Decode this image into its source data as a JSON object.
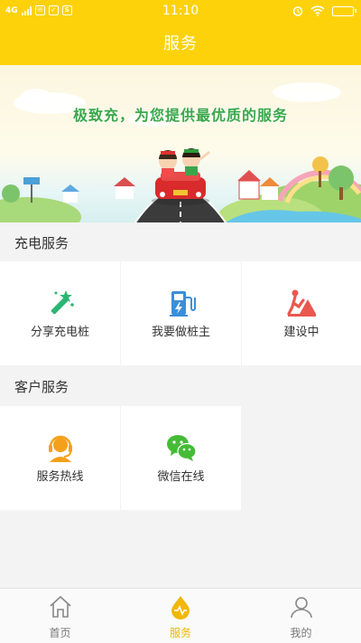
{
  "status_bar": {
    "network": "4G",
    "sim_label": "S",
    "time": "11:10"
  },
  "header": {
    "title": "服务"
  },
  "banner": {
    "slogan": "极致充，为您提供最优质的服务"
  },
  "charging_section": {
    "title": "充电服务",
    "items": [
      {
        "label": "分享充电桩",
        "icon": "magic-wand-icon"
      },
      {
        "label": "我要做桩主",
        "icon": "charging-station-icon"
      },
      {
        "label": "建设中",
        "icon": "construction-icon"
      }
    ]
  },
  "customer_section": {
    "title": "客户服务",
    "items": [
      {
        "label": "服务热线",
        "icon": "headset-icon"
      },
      {
        "label": "微信在线",
        "icon": "wechat-icon"
      }
    ]
  },
  "tabbar": {
    "items": [
      {
        "label": "首页",
        "icon": "home-icon",
        "active": false
      },
      {
        "label": "服务",
        "icon": "service-icon",
        "active": true
      },
      {
        "label": "我的",
        "icon": "user-icon",
        "active": false
      }
    ]
  },
  "colors": {
    "accent": "#fdd20a",
    "green": "#2bb673",
    "blue": "#3a8fd8",
    "red": "#e9584f",
    "orange": "#f5a01a",
    "wechat": "#46bb36"
  }
}
